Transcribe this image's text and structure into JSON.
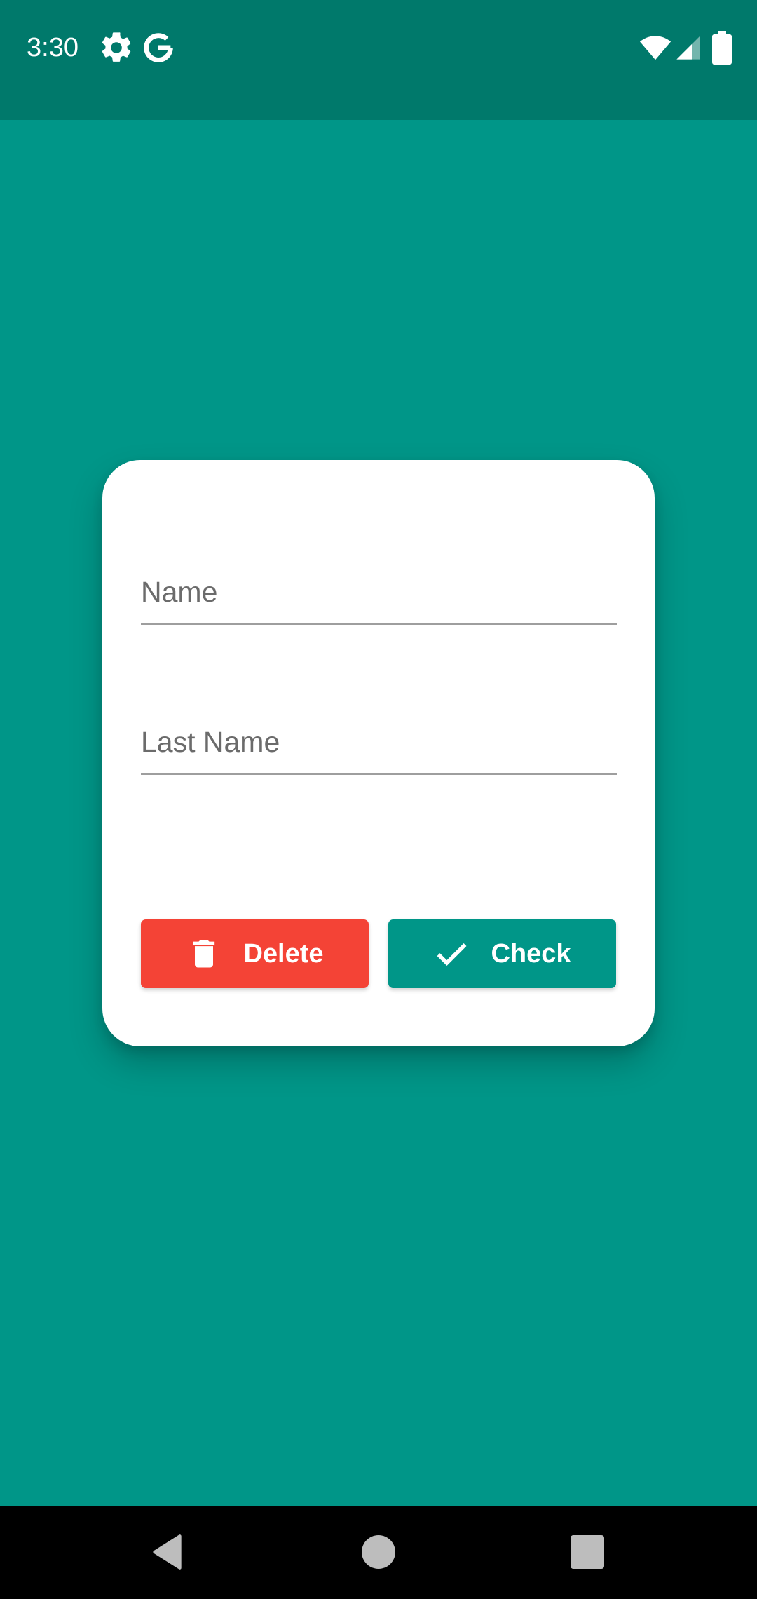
{
  "status_bar": {
    "time": "3:30",
    "icons": [
      "gear-icon",
      "google-g-icon",
      "wifi-icon",
      "cell-signal-icon",
      "battery-icon"
    ]
  },
  "form": {
    "name_label": "Name",
    "name_value": "",
    "last_name_label": "Last Name",
    "last_name_value": "",
    "delete_label": "Delete",
    "check_label": "Check"
  },
  "nav_bar": {
    "icons": [
      "back-icon",
      "home-icon",
      "recents-icon"
    ]
  },
  "colors": {
    "background": "#009688",
    "status_bar": "#00796B",
    "delete_button": "#F44336",
    "check_button": "#009688",
    "card": "#FFFFFF"
  }
}
